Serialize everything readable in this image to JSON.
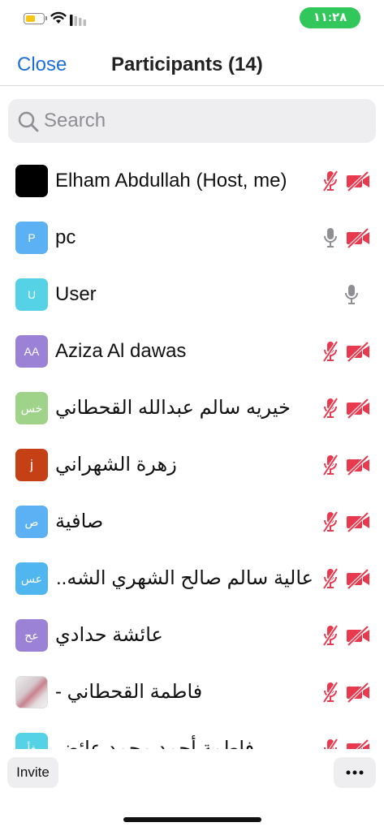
{
  "status_bar": {
    "time": "١١:٢٨",
    "time_pill_color": "#32c75a",
    "battery_color": "#f6c516",
    "icons": [
      "battery-icon",
      "wifi-icon",
      "signal-icon"
    ]
  },
  "header": {
    "close_label": "Close",
    "title": "Participants (14)",
    "accent_color": "#1e6fd9"
  },
  "search": {
    "placeholder": "Search",
    "value": ""
  },
  "participants": [
    {
      "name": "Elham Abdullah (Host, me)",
      "avatar_text": "",
      "mic": "muted",
      "video": "off"
    },
    {
      "name": "pc",
      "avatar_text": "P",
      "mic": "on",
      "video": "off"
    },
    {
      "name": "User",
      "avatar_text": "U",
      "mic": "on",
      "video": "none"
    },
    {
      "name": "Aziza Al dawas",
      "avatar_text": "AA",
      "mic": "muted",
      "video": "off"
    },
    {
      "name": "خيريه  سالم عبدالله القحطاني",
      "avatar_text": "خس",
      "mic": "muted",
      "video": "off"
    },
    {
      "name": "زهرة الشهراني",
      "avatar_text": "j",
      "mic": "muted",
      "video": "off"
    },
    {
      "name": "صافية",
      "avatar_text": "ص",
      "mic": "muted",
      "video": "off"
    },
    {
      "name": "عالية سالم صالح الشهري الشه...",
      "avatar_text": "عس",
      "mic": "muted",
      "video": "off"
    },
    {
      "name": "عائشة حدادي",
      "avatar_text": "عح",
      "mic": "muted",
      "video": "off"
    },
    {
      "name": "فاطمة القحطاني -",
      "avatar_text": "",
      "mic": "muted",
      "video": "off"
    },
    {
      "name": "فاطمة أحمد محمد عائض",
      "avatar_text": "فأ",
      "mic": "muted",
      "video": "off"
    }
  ],
  "muted_color": "#e8394f",
  "footer": {
    "invite_label": "Invite",
    "more_icon": "more-dots-icon"
  }
}
